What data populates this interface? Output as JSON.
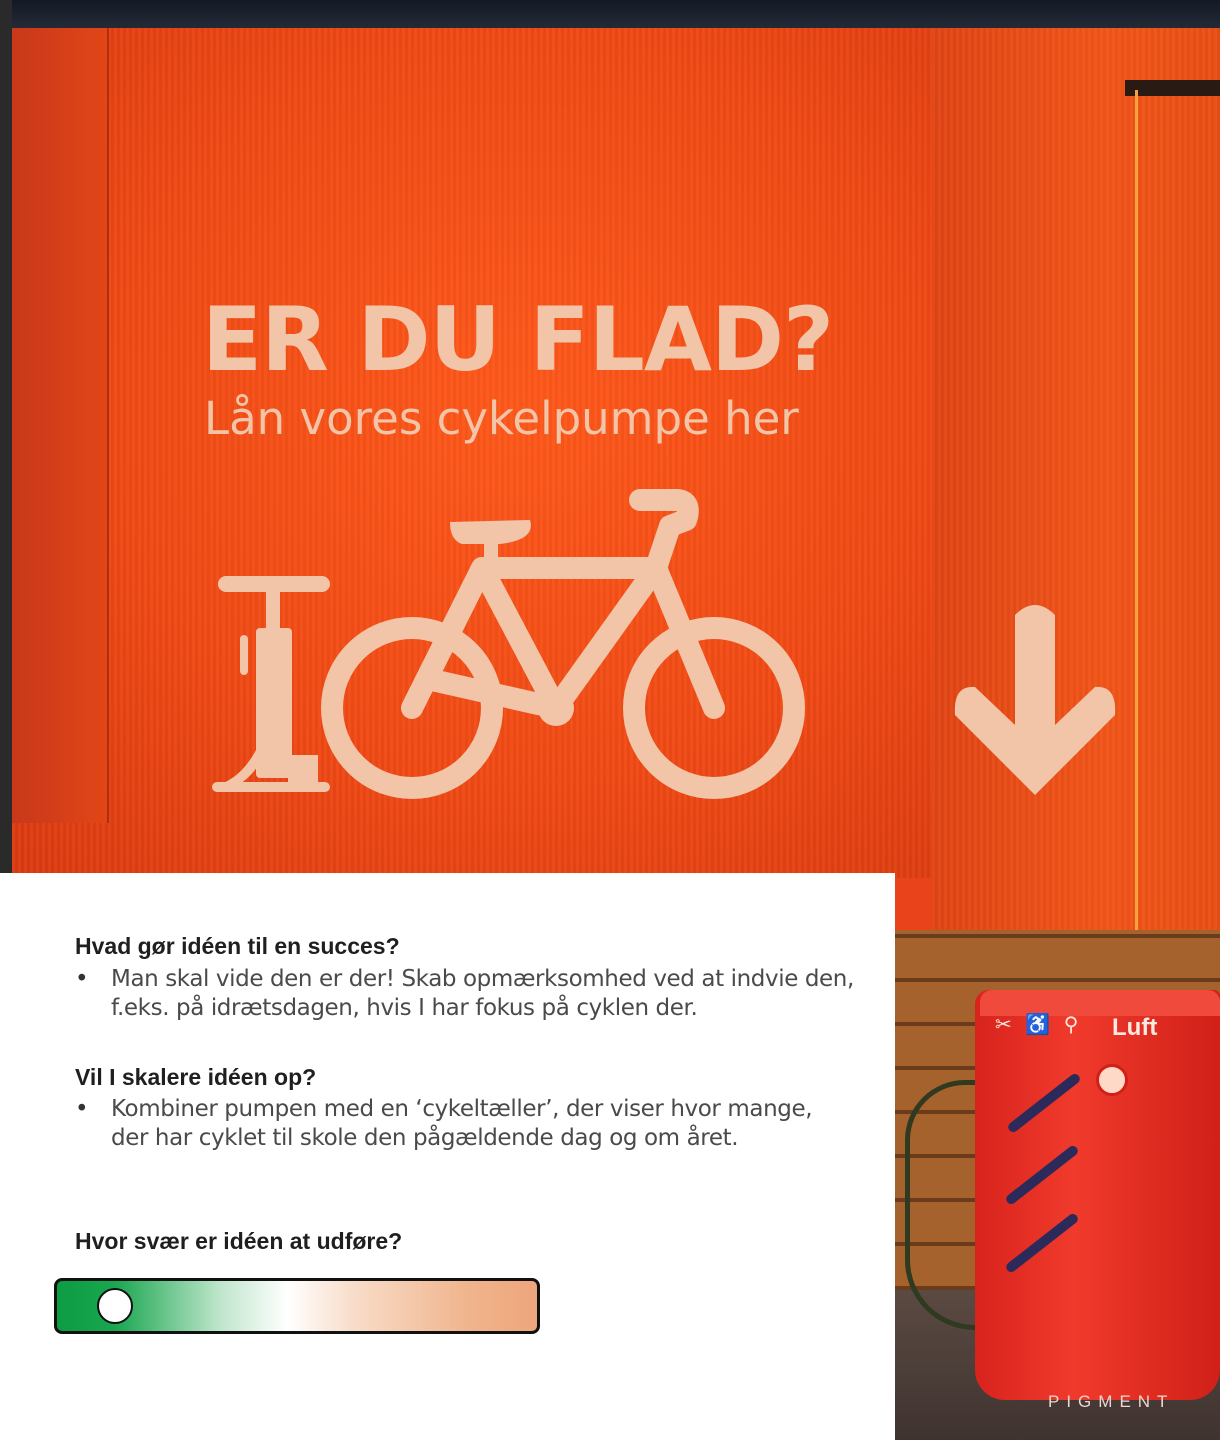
{
  "photo": {
    "sign_headline": "ER DU FLAD?",
    "sign_subline": "Lån vores cykelpumpe her",
    "pump_station_label": "Luft",
    "watermark": "PIGMENT"
  },
  "panel": {
    "sections": [
      {
        "title": "Hvad gør idéen til en succes?",
        "bullet": "Man skal vide den er der! Skab opmærksomhed ved at indvie den, f.eks. på idrætsdagen, hvis I har fokus på cyklen der."
      },
      {
        "title": "Vil I skalere idéen op?",
        "bullet": "Kombiner pumpen med en ‘cykeltæller’, der viser hvor mange, der har cyklet til skole den pågældende dag og om året."
      }
    ],
    "difficulty": {
      "title": "Hvor svær er idéen at udføre?",
      "level": 0.12
    }
  },
  "colors": {
    "wall_orange": "#f04a16",
    "sign_ink": "#f2c5a8",
    "pump_red": "#e8301f",
    "easy_green": "#0c9c44",
    "hard_orange": "#eea57c"
  },
  "icons": {
    "bullet": "•"
  }
}
